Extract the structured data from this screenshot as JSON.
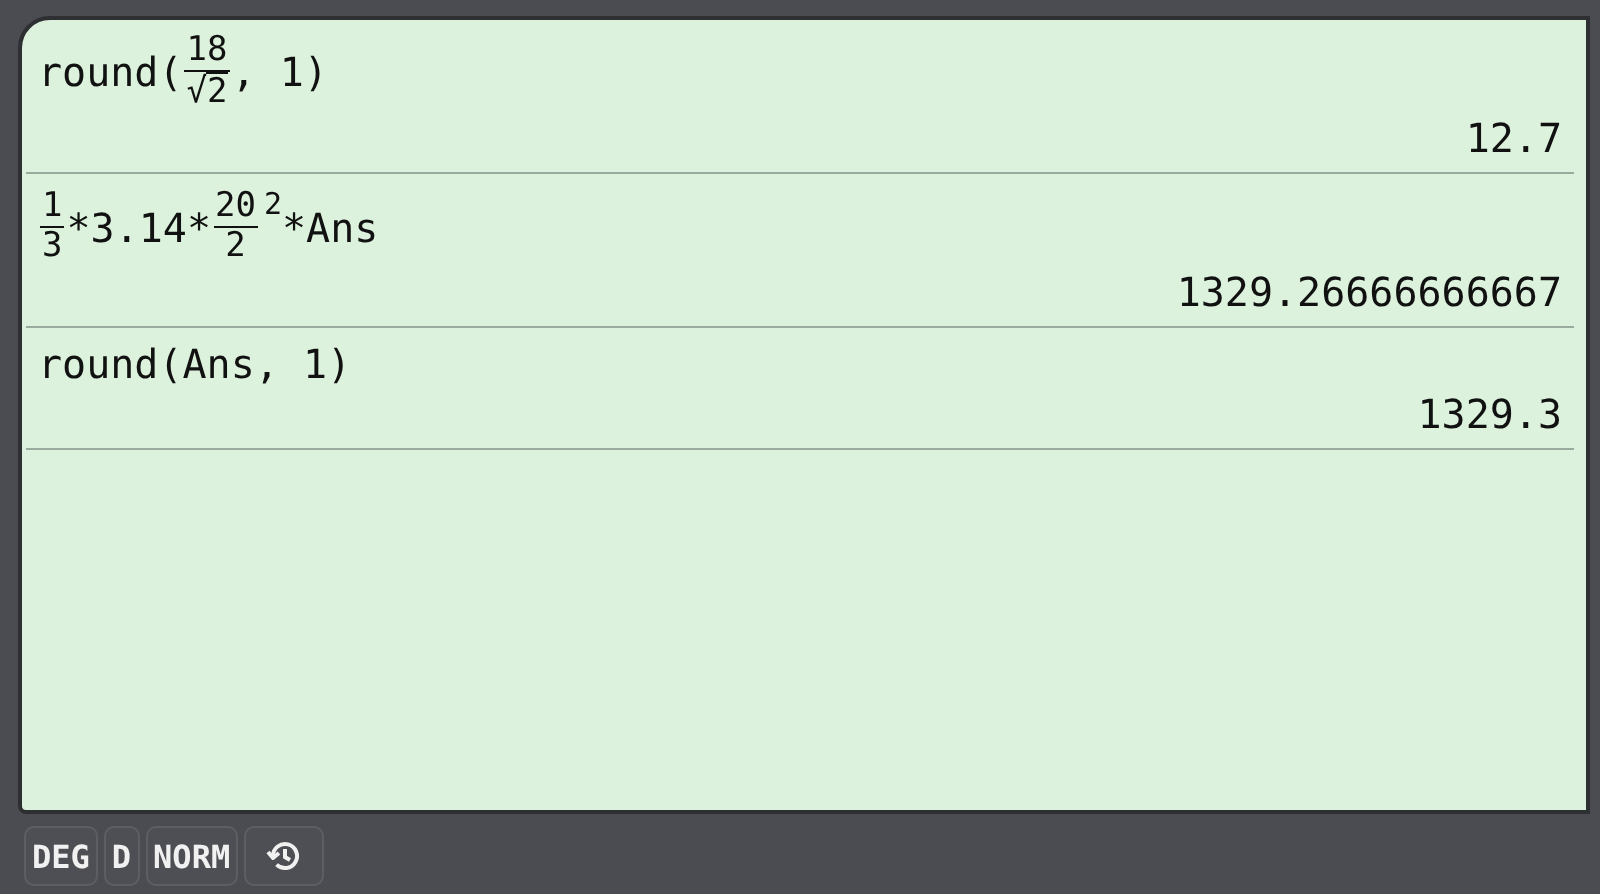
{
  "history": [
    {
      "expression": [
        {
          "kind": "text",
          "text": "round("
        },
        {
          "kind": "fraction",
          "numerator": [
            {
              "kind": "text",
              "text": "18"
            }
          ],
          "denominator": [
            {
              "kind": "sqrt",
              "symbol": "√",
              "text": "2"
            }
          ]
        },
        {
          "kind": "text",
          "text": ", 1)"
        }
      ],
      "result": "12.7"
    },
    {
      "expression": [
        {
          "kind": "fraction",
          "numerator": [
            {
              "kind": "text",
              "text": "1"
            }
          ],
          "denominator": [
            {
              "kind": "text",
              "text": "3"
            }
          ]
        },
        {
          "kind": "text",
          "text": "*3.14*"
        },
        {
          "kind": "fraction",
          "numerator": [
            {
              "kind": "text",
              "text": "20"
            }
          ],
          "denominator": [
            {
              "kind": "text",
              "text": "2"
            }
          ]
        },
        {
          "kind": "superscript",
          "text": "2"
        },
        {
          "kind": "text",
          "text": "*Ans"
        }
      ],
      "result": "1329.26666666667"
    },
    {
      "expression": [
        {
          "kind": "text",
          "text": "round(Ans, 1)"
        }
      ],
      "result": "1329.3"
    }
  ],
  "mode_buttons": [
    "DEG",
    "D",
    "NORM"
  ]
}
